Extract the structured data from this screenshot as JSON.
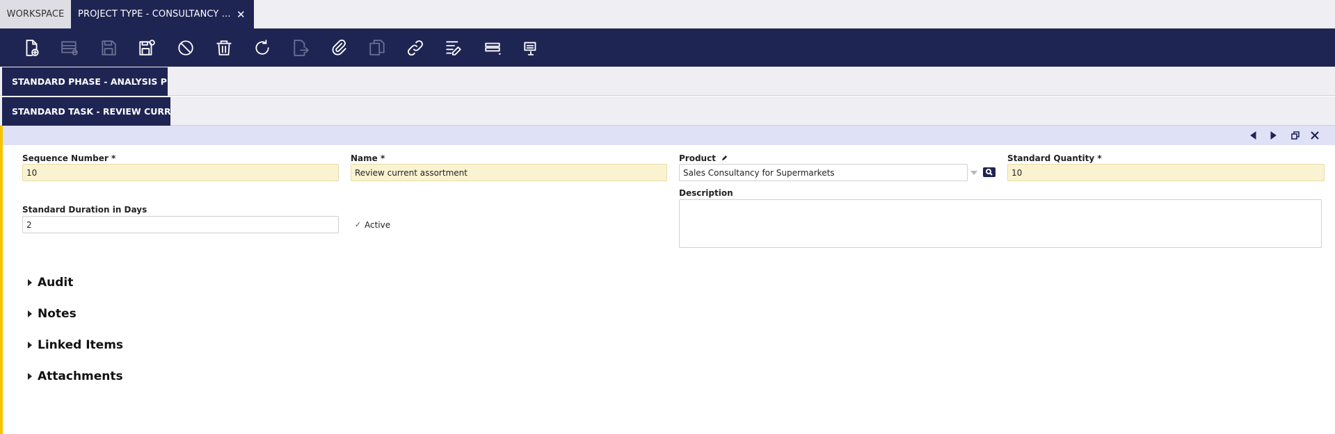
{
  "top_tabs": {
    "workspace": "WORKSPACE",
    "active": "PROJECT TYPE - CONSULTANCY PRO...",
    "close": "✕"
  },
  "sub_tabs": {
    "phase": "STANDARD PHASE - ANALYSIS PHAS...",
    "task": "STANDARD TASK - REVIEW CURRENT..."
  },
  "toolbar": [
    {
      "name": "new-document-icon",
      "enabled": true
    },
    {
      "name": "new-row-icon",
      "enabled": false
    },
    {
      "name": "save-icon",
      "enabled": false
    },
    {
      "name": "save-new-icon",
      "enabled": true
    },
    {
      "name": "cancel-icon",
      "enabled": true
    },
    {
      "name": "delete-icon",
      "enabled": true
    },
    {
      "name": "refresh-icon",
      "enabled": true
    },
    {
      "name": "export-icon",
      "enabled": false
    },
    {
      "name": "attachment-icon",
      "enabled": true
    },
    {
      "name": "copy-record-icon",
      "enabled": false
    },
    {
      "name": "link-icon",
      "enabled": true
    },
    {
      "name": "audit-trail-icon",
      "enabled": true
    },
    {
      "name": "grid-view-icon",
      "enabled": true
    },
    {
      "name": "clone-icon",
      "enabled": true
    }
  ],
  "form": {
    "sequence_number": {
      "label": "Sequence Number *",
      "value": "10"
    },
    "name": {
      "label": "Name *",
      "value": "Review current assortment"
    },
    "product": {
      "label": "Product",
      "value": "Sales Consultancy for Supermarkets"
    },
    "standard_quantity": {
      "label": "Standard Quantity *",
      "value": "10"
    },
    "standard_duration": {
      "label": "Standard Duration in Days",
      "value": "2"
    },
    "active": {
      "label": "Active",
      "checked": true,
      "mark": "✓"
    },
    "description": {
      "label": "Description",
      "value": ""
    }
  },
  "sections": {
    "audit": "Audit",
    "notes": "Notes",
    "linked_items": "Linked Items",
    "attachments": "Attachments"
  },
  "colors": {
    "brand": "#1f2553",
    "accent": "#f5c400",
    "required_bg": "#faf3d2"
  }
}
